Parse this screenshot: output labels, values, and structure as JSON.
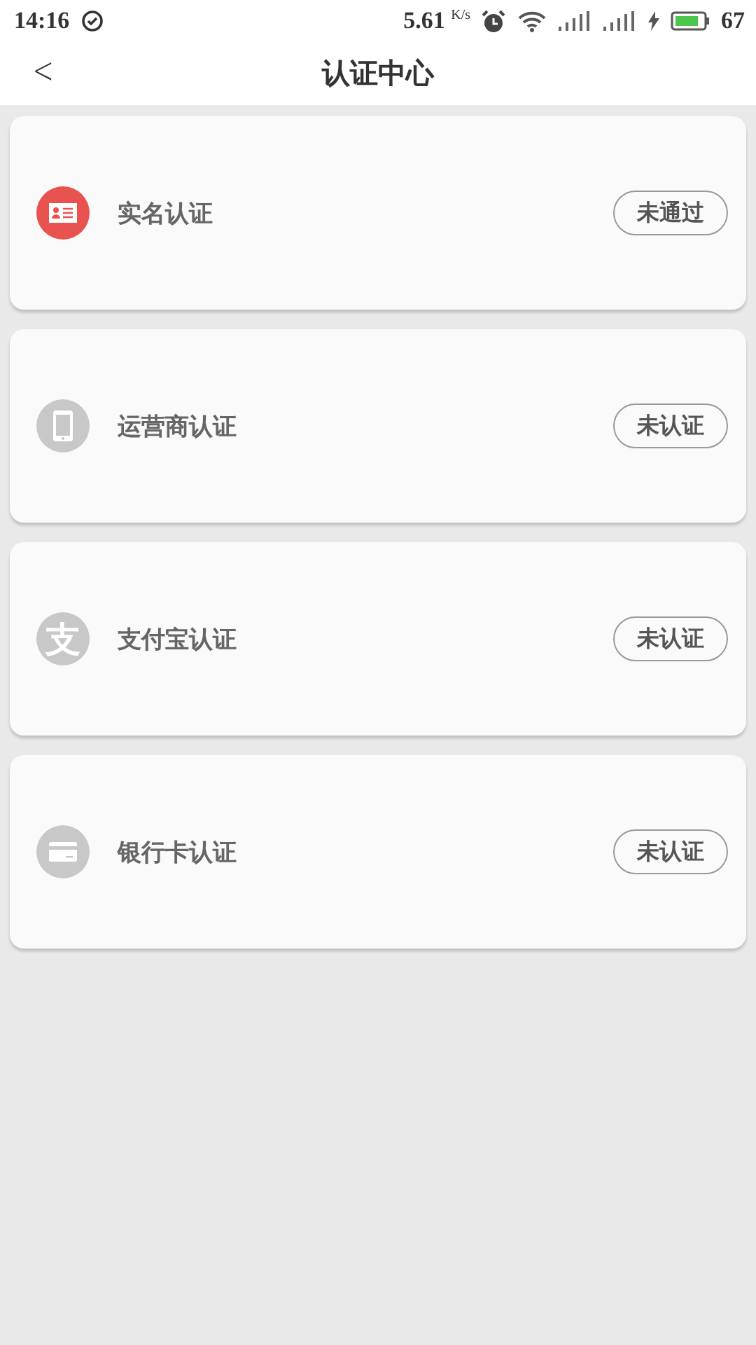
{
  "status_bar": {
    "time": "14:16",
    "speed": "5.61",
    "speed_unit": "K/s",
    "battery": "67"
  },
  "header": {
    "back": "<",
    "title": "认证中心"
  },
  "items": [
    {
      "label": "实名认证",
      "status": "未通过",
      "icon": {
        "kind": "id-card",
        "color": "#e8524f"
      }
    },
    {
      "label": "运营商认证",
      "status": "未认证",
      "icon": {
        "kind": "phone",
        "color": "#c8c8c8"
      }
    },
    {
      "label": "支付宝认证",
      "status": "未认证",
      "icon": {
        "kind": "glyph",
        "text": "支",
        "color": "#c8c8c8"
      }
    },
    {
      "label": "银行卡认证",
      "status": "未认证",
      "icon": {
        "kind": "bank-card",
        "color": "#c8c8c8"
      }
    }
  ]
}
